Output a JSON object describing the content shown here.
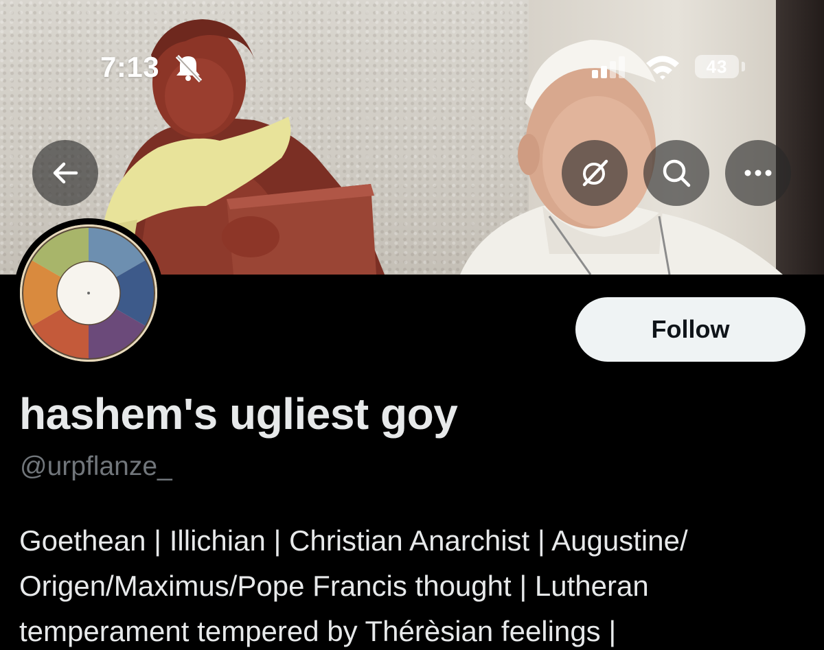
{
  "status_bar": {
    "time": "7:13",
    "battery": "43",
    "icons": [
      "bell-slash-icon",
      "cellular-signal-icon",
      "wifi-icon",
      "battery-icon"
    ]
  },
  "header_actions": {
    "back_icon": "arrow-left-icon",
    "grok_icon": "grok-slash-icon",
    "search_icon": "search-icon",
    "more_icon": "ellipsis-icon"
  },
  "profile": {
    "display_name": "hashem's ugliest goy",
    "handle": "@urpflanze_",
    "follow_label": "Follow",
    "bio_lines": [
      "Goethean | Illichian | Christian Anarchist | Augustine/",
      "Origen/Maximus/Pope Francis thought | Lutheran",
      "temperament tempered by Thérèsian feelings |"
    ]
  },
  "colors": {
    "background": "#000000",
    "primary_text": "#e7e9ea",
    "secondary_text": "#71767b",
    "follow_button_bg": "#eff3f4",
    "follow_button_text": "#0f1419"
  }
}
